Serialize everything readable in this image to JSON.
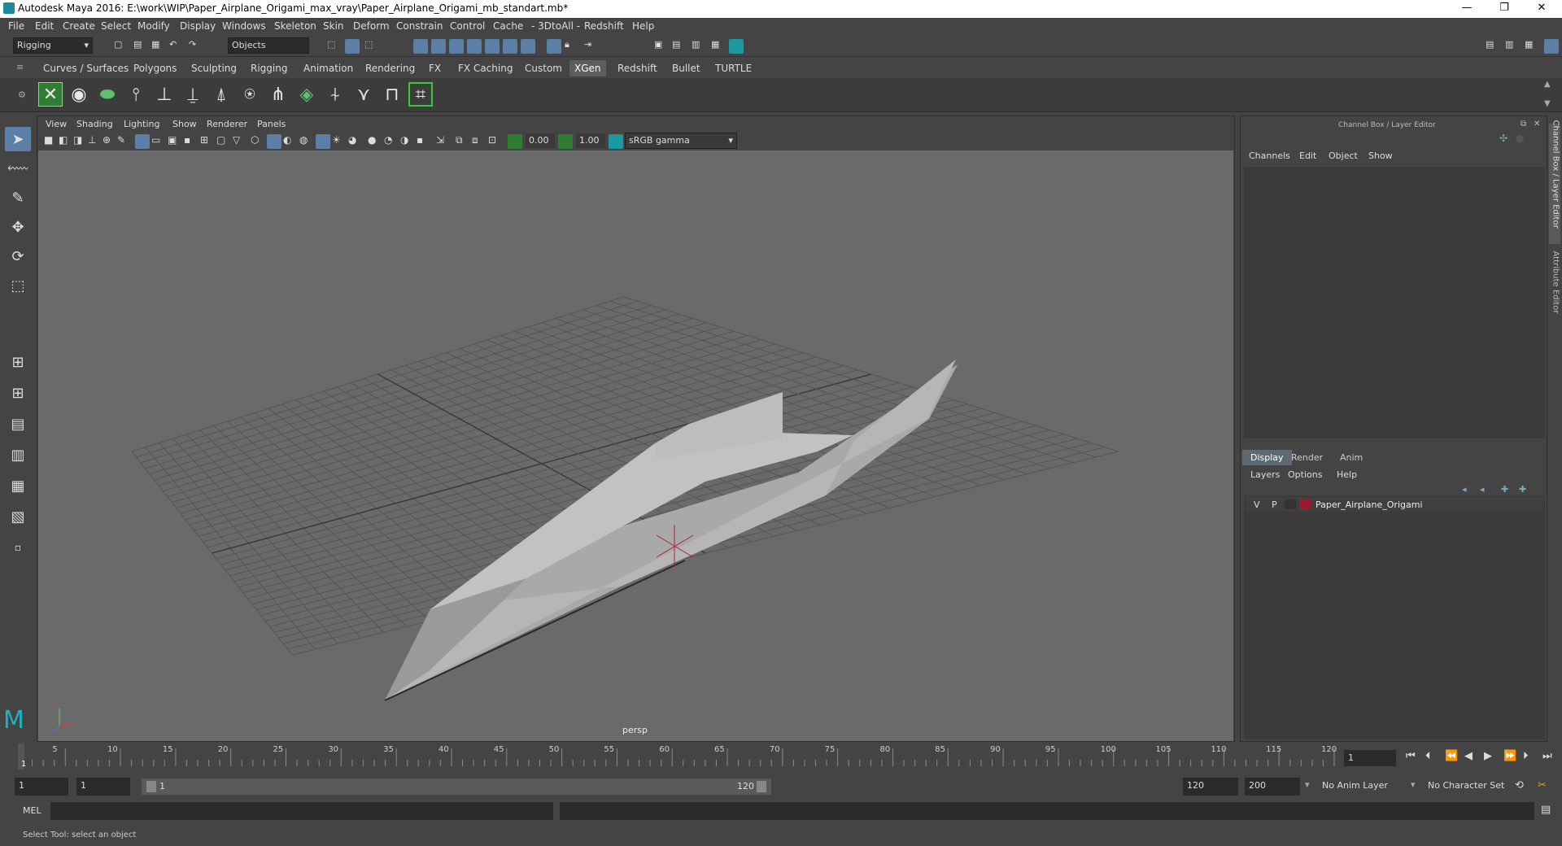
{
  "window": {
    "title": "Autodesk Maya 2016: E:\\work\\WIP\\Paper_Airplane_Origami_max_vray\\Paper_Airplane_Origami_mb_standart.mb*",
    "minimize": "—",
    "restore": "❐",
    "close": "✕"
  },
  "menubar": [
    "File",
    "Edit",
    "Create",
    "Select",
    "Modify",
    "Display",
    "Windows",
    "Skeleton",
    "Skin",
    "Deform",
    "Constrain",
    "Control",
    "Cache",
    "- 3DtoAll -",
    "Redshift",
    "Help"
  ],
  "statusline": {
    "mode_dropdown": "Rigging",
    "select_dropdown": "Objects"
  },
  "shelf_tabs": [
    "Curves / Surfaces",
    "Polygons",
    "Sculpting",
    "Rigging",
    "Animation",
    "Rendering",
    "FX",
    "FX Caching",
    "Custom",
    "XGen",
    "Redshift",
    "Bullet",
    "TURTLE"
  ],
  "shelf_active": "XGen",
  "viewport": {
    "menu": [
      "View",
      "Shading",
      "Lighting",
      "Show",
      "Renderer",
      "Panels"
    ],
    "exposure": "0.00",
    "gamma": "1.00",
    "color_space": "sRGB gamma",
    "camera_label": "persp"
  },
  "channel_box": {
    "header": "Channel Box / Layer Editor",
    "menu": [
      "Channels",
      "Edit",
      "Object",
      "Show"
    ]
  },
  "layer_editor": {
    "tabs": [
      "Display",
      "Render",
      "Anim"
    ],
    "active_tab": "Display",
    "menu": [
      "Layers",
      "Options",
      "Help"
    ],
    "layers": [
      {
        "v": "V",
        "p": "P",
        "color": "#9b1b2e",
        "name": "Paper_Airplane_Origami"
      }
    ]
  },
  "side_tabs": [
    "Channel Box / Layer Editor",
    "Attribute Editor"
  ],
  "timeline": {
    "ticks": [
      5,
      10,
      15,
      20,
      25,
      30,
      35,
      40,
      45,
      50,
      55,
      60,
      65,
      70,
      75,
      80,
      85,
      90,
      95,
      100,
      105,
      110,
      115,
      120
    ],
    "start_label": "1",
    "current_frame": "1"
  },
  "range": {
    "start": "1",
    "playback_start": "1",
    "slider_start": "1",
    "slider_end": "120",
    "playback_end": "120",
    "end": "200",
    "anim_layer": "No Anim Layer",
    "character_set": "No Character Set"
  },
  "cmdline": {
    "label": "MEL"
  },
  "helpline": {
    "text": "Select Tool: select an object"
  }
}
